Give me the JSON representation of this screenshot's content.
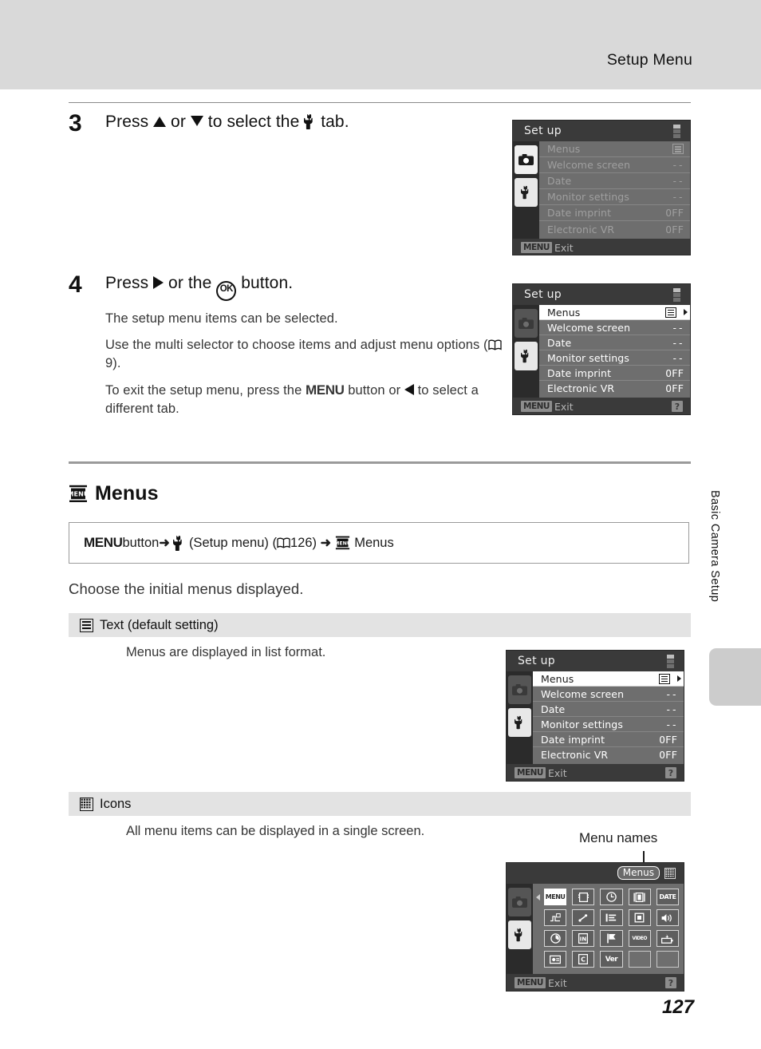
{
  "header": {
    "title": "Setup Menu"
  },
  "side_tab": {
    "label": "Basic Camera Setup"
  },
  "page_number": "127",
  "steps": [
    {
      "number": "3",
      "title_pre": "Press ",
      "title_mid": " or ",
      "title_post": " to select the ",
      "title_end": " tab."
    },
    {
      "number": "4",
      "title_pre": "Press ",
      "title_mid": " or the ",
      "title_post": " button.",
      "paras": [
        "The setup menu items can be selected.",
        "Use the multi selector to choose items and adjust menu options (",
        "9).",
        "To exit the setup menu, press the ",
        " button or ",
        " to select a different tab."
      ]
    }
  ],
  "section": {
    "heading": "Menus",
    "path": {
      "menu_button": "MENU",
      "button_word": " button ",
      "arrow": "➜",
      "setup_menu": "(Setup menu) (",
      "page_ref": "126)",
      "arrow2": "➜",
      "target": "Menus"
    },
    "description": "Choose the initial menus displayed.",
    "options": [
      {
        "label": "Text (default setting)",
        "description": "Menus are displayed in list format.",
        "icon": "list-icon"
      },
      {
        "label": "Icons",
        "description": "All menu items can be displayed in a single screen.",
        "icon": "grid-icon"
      }
    ]
  },
  "callout": {
    "menu_names": "Menu names"
  },
  "lcd_screens": {
    "step3": {
      "title": "Set up",
      "rows": [
        {
          "label": "Menus",
          "value": "list-icon"
        },
        {
          "label": "Welcome screen",
          "value": "--"
        },
        {
          "label": "Date",
          "value": "--"
        },
        {
          "label": "Monitor settings",
          "value": "--"
        },
        {
          "label": "Date imprint",
          "value": "OFF"
        },
        {
          "label": "Electronic VR",
          "value": "OFF"
        }
      ],
      "footer": {
        "chip": "MENU",
        "label": "Exit"
      }
    },
    "step4": {
      "title": "Set up",
      "rows": [
        {
          "label": "Menus",
          "value": "list-icon",
          "selected": true
        },
        {
          "label": "Welcome screen",
          "value": "--"
        },
        {
          "label": "Date",
          "value": "--"
        },
        {
          "label": "Monitor settings",
          "value": "--"
        },
        {
          "label": "Date imprint",
          "value": "OFF"
        },
        {
          "label": "Electronic VR",
          "value": "OFF"
        }
      ],
      "footer": {
        "chip": "MENU",
        "label": "Exit",
        "help": "?"
      }
    },
    "text_mode": {
      "title": "Set up",
      "rows": [
        {
          "label": "Menus",
          "value": "list-icon",
          "selected": true
        },
        {
          "label": "Welcome screen",
          "value": "--"
        },
        {
          "label": "Date",
          "value": "--"
        },
        {
          "label": "Monitor settings",
          "value": "--"
        },
        {
          "label": "Date imprint",
          "value": "OFF"
        },
        {
          "label": "Electronic VR",
          "value": "OFF"
        }
      ],
      "footer": {
        "chip": "MENU",
        "label": "Exit",
        "help": "?"
      }
    },
    "icon_mode": {
      "badge": "Menus",
      "cells": [
        {
          "glyph": "MENU",
          "name": "menus-icon",
          "selected": true
        },
        {
          "glyph": "",
          "name": "welcome-screen-icon"
        },
        {
          "glyph": "",
          "name": "date-icon"
        },
        {
          "glyph": "",
          "name": "monitor-settings-icon"
        },
        {
          "glyph": "DATE",
          "name": "date-imprint-icon"
        },
        {
          "glyph": "",
          "name": "electronic-vr-icon"
        },
        {
          "glyph": "",
          "name": "motion-detection-icon"
        },
        {
          "glyph": "",
          "name": "af-assist-icon"
        },
        {
          "glyph": "",
          "name": "digital-zoom-icon"
        },
        {
          "glyph": "",
          "name": "sound-settings-icon"
        },
        {
          "glyph": "",
          "name": "auto-off-icon"
        },
        {
          "glyph": "IN",
          "name": "format-memory-icon"
        },
        {
          "glyph": "",
          "name": "language-icon"
        },
        {
          "glyph": "VIDEO",
          "name": "video-mode-icon"
        },
        {
          "glyph": "",
          "name": "blink-warning-icon"
        },
        {
          "glyph": "",
          "name": "charge-by-computer-icon"
        },
        {
          "glyph": "",
          "name": "eye-fi-upload-icon"
        },
        {
          "glyph": "Ver",
          "name": "firmware-version-icon"
        },
        {
          "glyph": "",
          "name": "blank-cell",
          "blank": true
        },
        {
          "glyph": "",
          "name": "blank-cell",
          "blank": true
        }
      ],
      "footer": {
        "chip": "MENU",
        "label": "Exit",
        "help": "?"
      }
    }
  },
  "colors": {
    "header_band": "#d9d9d9",
    "option_bar": "#e3e3e3",
    "lcd_body": "#6e6e6e",
    "lcd_chrome": "#3a3a3a",
    "side_tab": "#cccccc"
  }
}
